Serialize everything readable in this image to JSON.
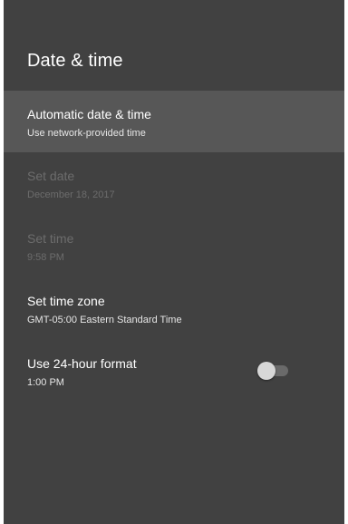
{
  "header": {
    "title": "Date & time"
  },
  "settings": [
    {
      "title": "Automatic date & time",
      "subtitle": "Use network-provided time",
      "state": "focused"
    },
    {
      "title": "Set date",
      "subtitle": "December 18, 2017",
      "state": "disabled"
    },
    {
      "title": "Set time",
      "subtitle": "9:58 PM",
      "state": "disabled"
    },
    {
      "title": "Set time zone",
      "subtitle": "GMT-05:00 Eastern Standard Time",
      "state": "enabled"
    },
    {
      "title": "Use 24-hour format",
      "subtitle": "1:00 PM",
      "state": "enabled",
      "toggle": {
        "on": false
      }
    }
  ],
  "colors": {
    "panel_background": "#414141",
    "focused_row": "#575757",
    "text_primary": "#ffffff",
    "text_disabled": "#6c6c6c",
    "toggle_thumb": "#d7d7d7",
    "toggle_track": "#6a6a6a"
  }
}
